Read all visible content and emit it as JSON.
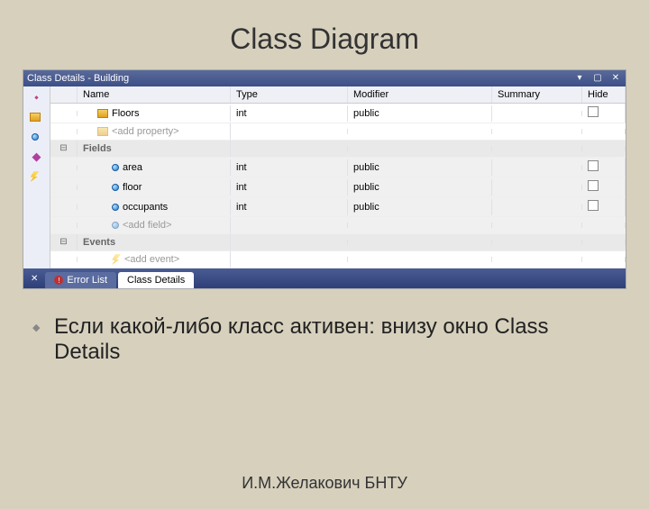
{
  "title": "Class Diagram",
  "panel": {
    "title": "Class Details - Building",
    "columns": [
      "Name",
      "Type",
      "Modifier",
      "Summary",
      "Hide"
    ],
    "properties": [
      {
        "name": "Floors",
        "type": "int",
        "modifier": "public"
      }
    ],
    "add_property_placeholder": "<add property>",
    "fields_group_label": "Fields",
    "fields": [
      {
        "name": "area",
        "type": "int",
        "modifier": "public"
      },
      {
        "name": "floor",
        "type": "int",
        "modifier": "public"
      },
      {
        "name": "occupants",
        "type": "int",
        "modifier": "public"
      }
    ],
    "add_field_placeholder": "<add field>",
    "events_group_label": "Events",
    "add_event_placeholder": "<add event>"
  },
  "tabs": {
    "error_list": "Error List",
    "class_details": "Class Details"
  },
  "bullet": "Если какой-либо класс активен: внизу окно Class Details",
  "footer": "И.М.Желакович БНТУ"
}
